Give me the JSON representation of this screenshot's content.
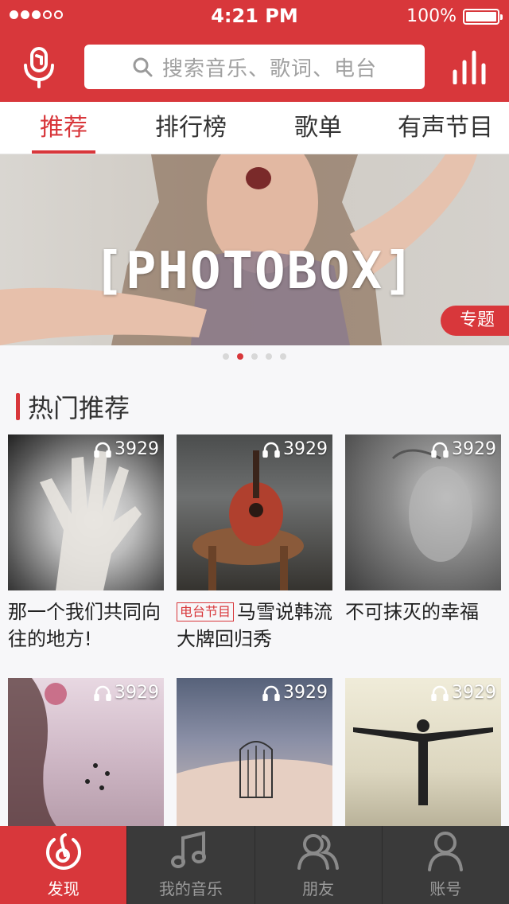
{
  "status": {
    "time": "4:21 PM",
    "battery": "100%"
  },
  "header": {
    "search_placeholder": "搜索音乐、歌词、电台",
    "mic_icon": "microphone-icon",
    "eq_icon": "equalizer-icon",
    "search_icon": "search-icon"
  },
  "tabs": [
    {
      "label": "推荐"
    },
    {
      "label": "排行榜"
    },
    {
      "label": "歌单"
    },
    {
      "label": "有声节目"
    }
  ],
  "banner": {
    "text": "[PHOTOBOX]",
    "tag": "专题",
    "page_count": 5,
    "current_page": 2
  },
  "section": {
    "title": "热门推荐"
  },
  "cards": [
    {
      "plays": "3929",
      "title": "那一个我们共同向往的地方!"
    },
    {
      "plays": "3929",
      "tag": "电台节目",
      "title": "马雪说韩流大牌回归秀"
    },
    {
      "plays": "3929",
      "title": "不可抹灭的幸福"
    },
    {
      "plays": "3929",
      "title": ""
    },
    {
      "plays": "3929",
      "title": ""
    },
    {
      "plays": "3929",
      "title": ""
    }
  ],
  "bottom_nav": [
    {
      "label": "发现",
      "icon": "music-note-circle-icon"
    },
    {
      "label": "我的音乐",
      "icon": "music-note-icon"
    },
    {
      "label": "朋友",
      "icon": "friends-icon"
    },
    {
      "label": "账号",
      "icon": "account-icon"
    }
  ],
  "colors": {
    "brand": "#d8373b",
    "bottom_bar": "#3a3a3a"
  }
}
